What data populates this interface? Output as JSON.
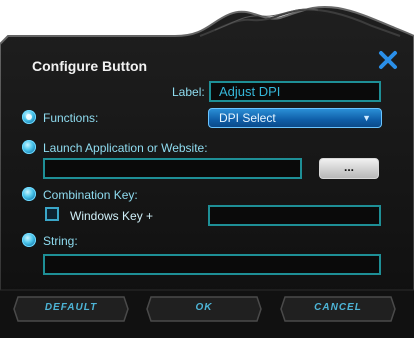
{
  "dialog": {
    "title": "Configure Button",
    "label_caption": "Label:",
    "label_value": "Adjust DPI"
  },
  "options": {
    "functions": {
      "label": "Functions:",
      "selected_value": "DPI Select"
    },
    "launch": {
      "label": "Launch Application or Website:",
      "value": "",
      "browse_label": "..."
    },
    "combination": {
      "label": "Combination Key:",
      "windows_key_label": "Windows Key +",
      "value": ""
    },
    "string": {
      "label": "String:",
      "value": ""
    }
  },
  "footer": {
    "default_label": "DEFAULT",
    "ok_label": "OK",
    "cancel_label": "CANCEL"
  },
  "colors": {
    "background": "#161616",
    "accent": "#1e8f96",
    "label_text": "#8fdcf0",
    "close_icon": "#2a8fe8"
  }
}
